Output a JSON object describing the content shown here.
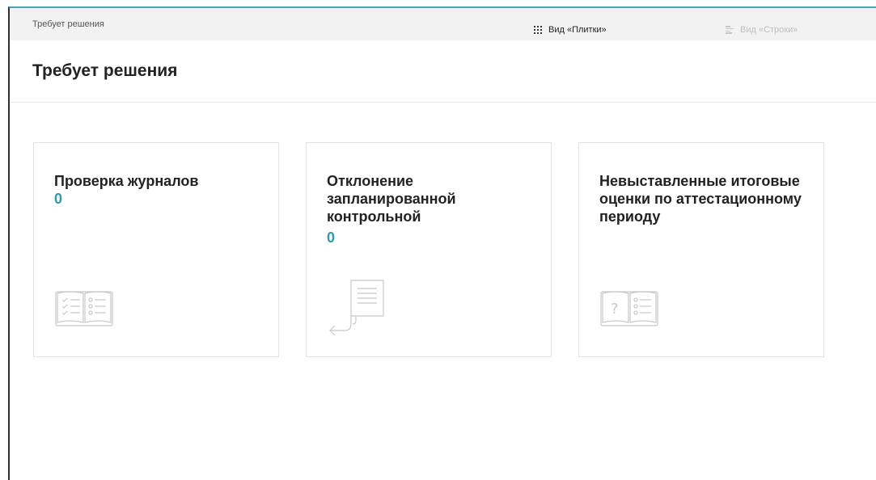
{
  "breadcrumb": "Требует решения",
  "header": {
    "title": "Требует решения",
    "view_tiles_label": "Вид «Плитки»",
    "view_rows_label": "Вид «Строки»"
  },
  "cards": [
    {
      "title": "Проверка журналов",
      "count": "0",
      "icon": "journal-check-icon"
    },
    {
      "title": "Отклонение запланированной контрольной",
      "count": "0",
      "icon": "document-return-icon"
    },
    {
      "title": "Невыставленные итоговые оценки по аттестационному периоду",
      "count": "",
      "icon": "journal-question-icon"
    }
  ],
  "colors": {
    "accent": "#2d9cb0",
    "border": "#e3e3e3",
    "breadcrumb_bg": "#f2f2f2"
  }
}
